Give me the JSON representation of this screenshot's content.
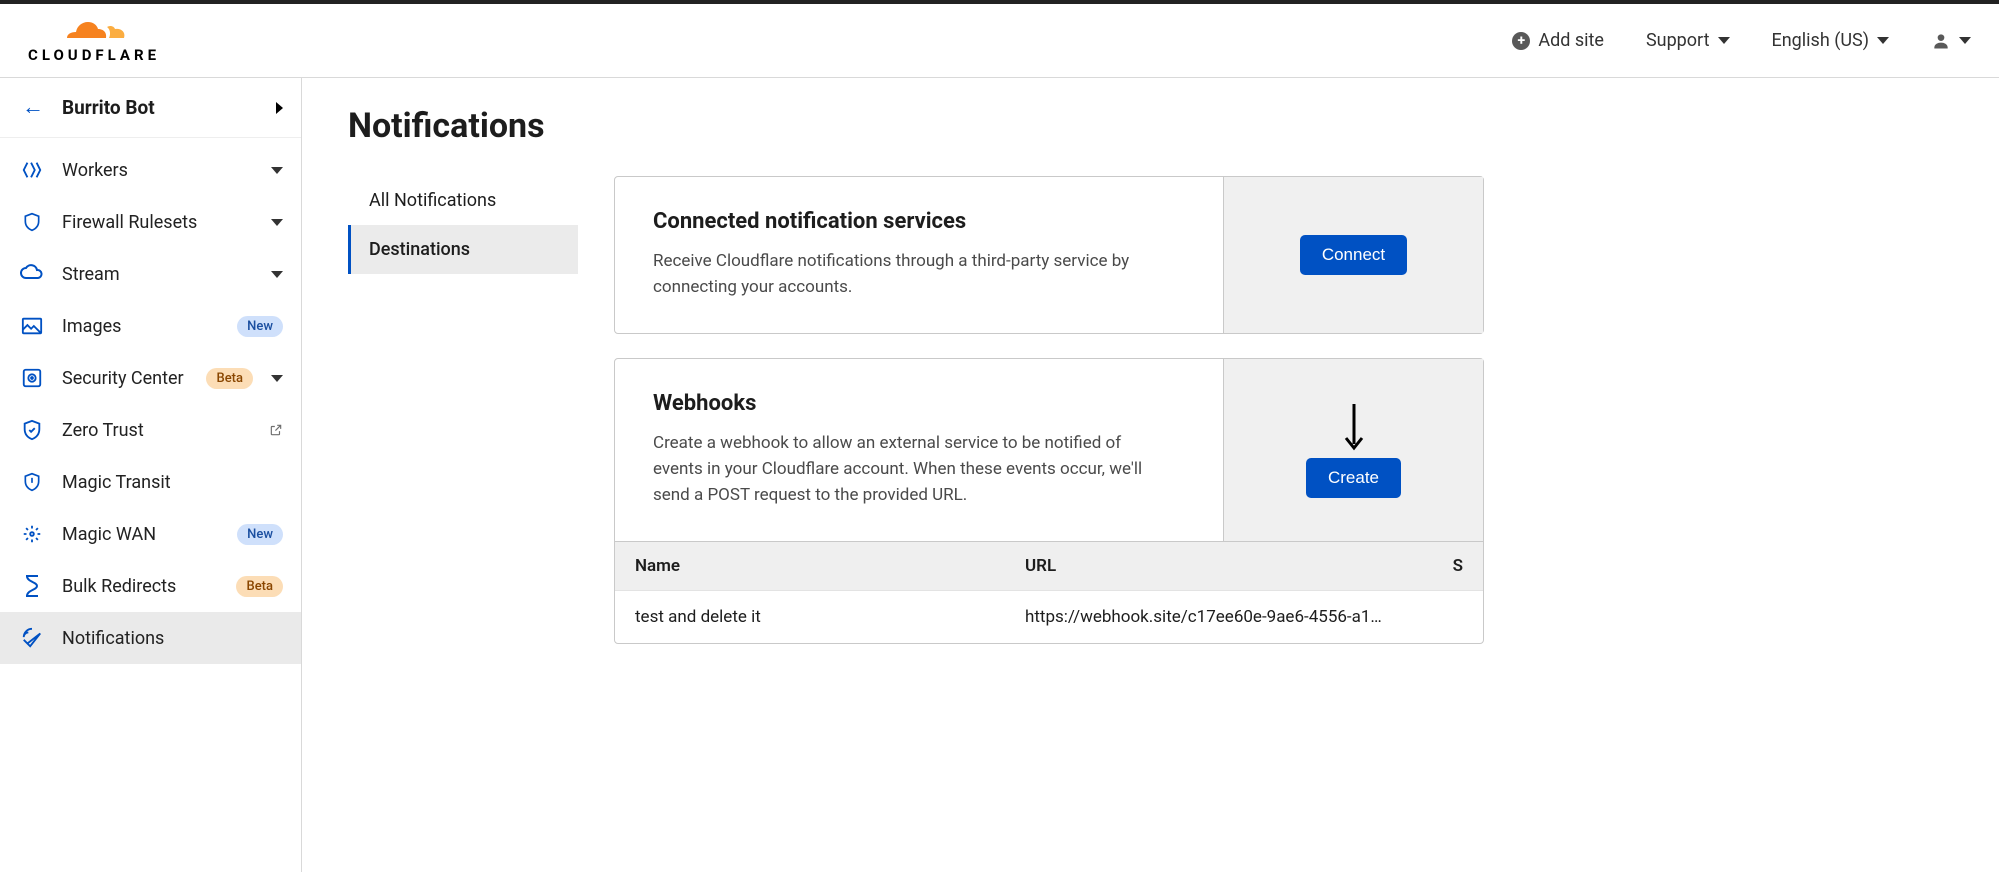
{
  "header": {
    "brand": "CLOUDFLARE",
    "add_site": "Add site",
    "support": "Support",
    "language": "English (US)"
  },
  "sidebar": {
    "account_name": "Burrito Bot",
    "items": [
      {
        "id": "workers",
        "label": "Workers",
        "expandable": true
      },
      {
        "id": "firewall-rulesets",
        "label": "Firewall Rulesets",
        "expandable": true
      },
      {
        "id": "stream",
        "label": "Stream",
        "expandable": true
      },
      {
        "id": "images",
        "label": "Images",
        "badge": "New",
        "badge_kind": "new"
      },
      {
        "id": "security-center",
        "label": "Security Center",
        "badge": "Beta",
        "badge_kind": "beta",
        "expandable": true
      },
      {
        "id": "zero-trust",
        "label": "Zero Trust",
        "external": true
      },
      {
        "id": "magic-transit",
        "label": "Magic Transit"
      },
      {
        "id": "magic-wan",
        "label": "Magic WAN",
        "badge": "New",
        "badge_kind": "new"
      },
      {
        "id": "bulk-redirects",
        "label": "Bulk Redirects",
        "badge": "Beta",
        "badge_kind": "beta"
      },
      {
        "id": "notifications",
        "label": "Notifications",
        "active": true
      }
    ]
  },
  "page": {
    "title": "Notifications",
    "subtabs": [
      {
        "id": "all",
        "label": "All Notifications"
      },
      {
        "id": "destinations",
        "label": "Destinations",
        "active": true
      }
    ],
    "connected": {
      "title": "Connected notification services",
      "desc": "Receive Cloudflare notifications through a third-party service by connecting your accounts.",
      "button": "Connect"
    },
    "webhooks": {
      "title": "Webhooks",
      "desc": "Create a webhook to allow an external service to be notified of events in your Cloudflare account. When these events occur, we'll send a POST request to the provided URL.",
      "button": "Create",
      "columns": {
        "name": "Name",
        "url": "URL",
        "s": "S"
      },
      "rows": [
        {
          "name": "test and delete it",
          "url": "https://webhook.site/c17ee60e-9ae6-4556-a1…"
        }
      ]
    }
  }
}
